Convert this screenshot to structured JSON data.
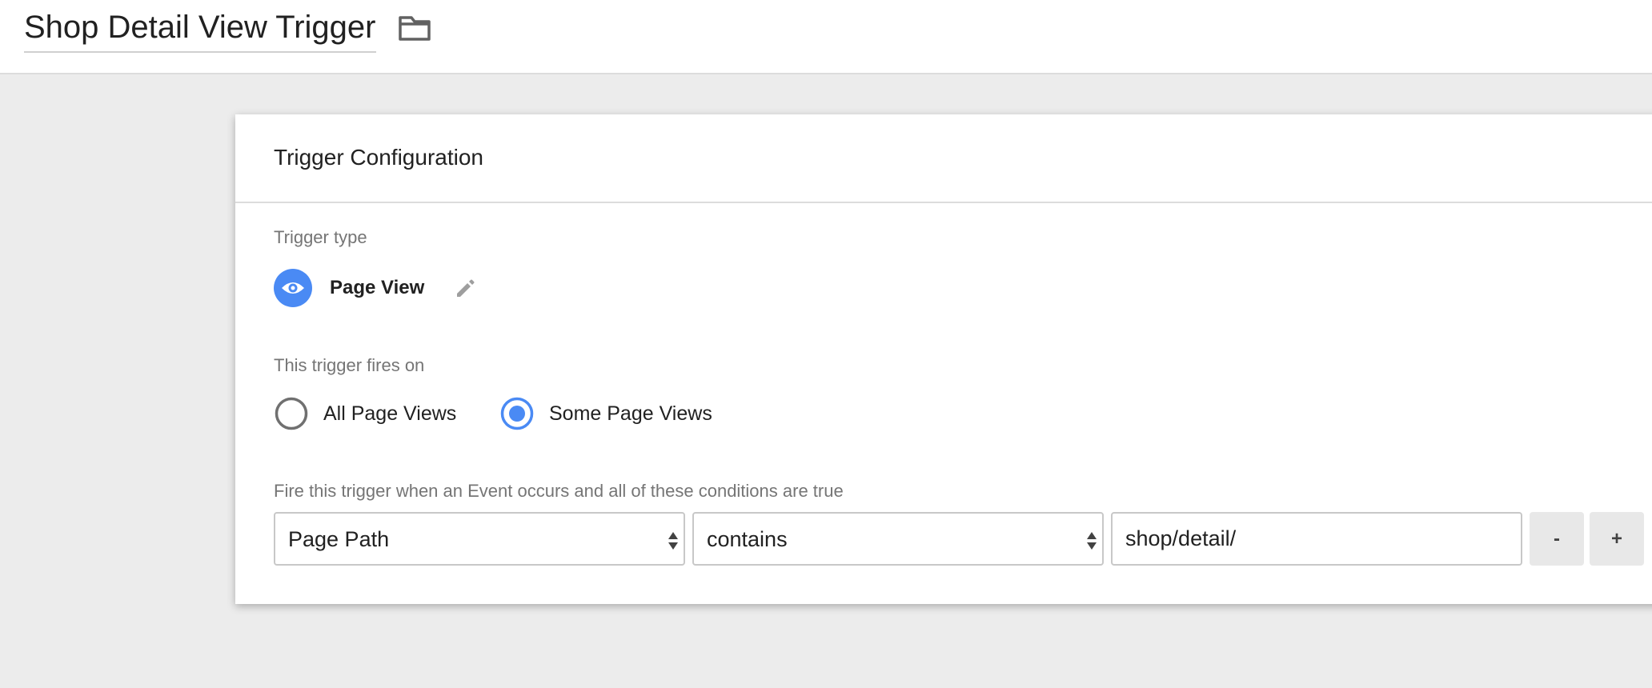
{
  "header": {
    "title": "Shop Detail View Trigger",
    "folder_icon": "folder-icon"
  },
  "trigger_config": {
    "heading": "Trigger Configuration",
    "trigger_type_label": "Trigger type",
    "trigger_type": {
      "name": "Page View",
      "icon": "eye-icon",
      "icon_color": "#4a8af4",
      "edit_icon": "pencil-icon"
    },
    "fires_on_label": "This trigger fires on",
    "fires_on_options": [
      {
        "label": "All Page Views",
        "selected": false
      },
      {
        "label": "Some Page Views",
        "selected": true
      }
    ],
    "conditions_label": "Fire this trigger when an Event occurs and all of these conditions are true",
    "condition": {
      "variable": "Page Path",
      "operator": "contains",
      "value": "shop/detail/",
      "remove_label": "-",
      "add_label": "+"
    }
  },
  "colors": {
    "accent": "#4a8af4",
    "background": "#ececec",
    "text": "#212121",
    "muted_text": "#757575"
  }
}
